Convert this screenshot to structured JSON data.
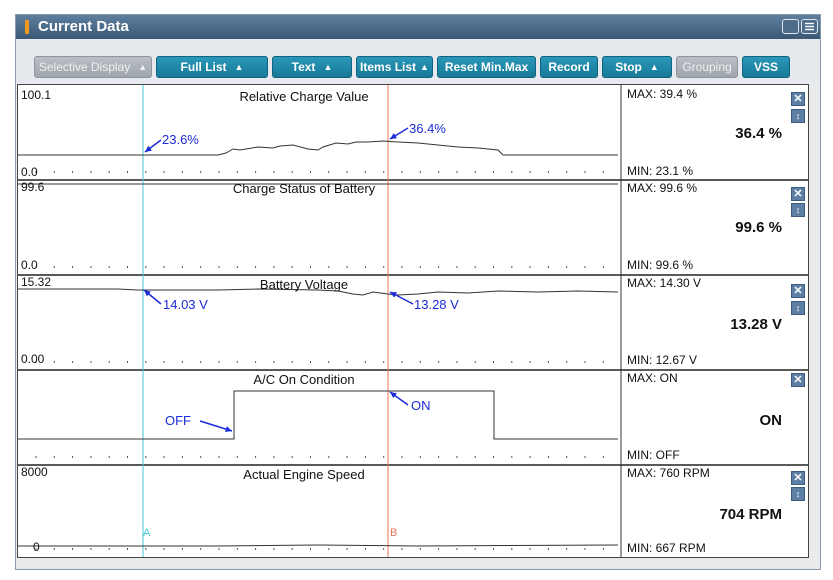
{
  "window": {
    "title": "Current Data"
  },
  "toolbar": {
    "selective_display": "Selective Display",
    "full_list": "Full List",
    "text": "Text",
    "items_list": "Items List",
    "reset_minmax": "Reset Min.Max",
    "record": "Record",
    "stop": "Stop",
    "grouping": "Grouping",
    "vss": "VSS"
  },
  "colors": {
    "accent": "#1e88ab",
    "cursor_a": "#46c6d6",
    "cursor_b": "#e8735a",
    "annotation": "#1b2bd8"
  },
  "cursors": {
    "a_label": "A",
    "b_label": "B"
  },
  "panels": [
    {
      "title": "Relative Charge Value",
      "ymax": "100.1",
      "ymin": "0.0",
      "max": "MAX:  39.4 %",
      "min": "MIN:  23.1 %",
      "current": "36.4 %",
      "annotation_a": "23.6%",
      "annotation_b": "36.4%"
    },
    {
      "title": "Charge Status of Battery",
      "ymax": "99.6",
      "ymin": "0.0",
      "max": "MAX:  99.6 %",
      "min": "MIN:  99.6 %",
      "current": "99.6 %"
    },
    {
      "title": "Battery Voltage",
      "ymax": "15.32",
      "ymin": "0.00",
      "max": "MAX:  14.30 V",
      "min": "MIN:  12.67 V",
      "current": "13.28 V",
      "annotation_a": "14.03 V",
      "annotation_b": "13.28 V"
    },
    {
      "title": "A/C On Condition",
      "max": "MAX:  ON",
      "min": "MIN:  OFF",
      "current": "ON",
      "annotation_a": "OFF",
      "annotation_b": "ON"
    },
    {
      "title": "Actual Engine Speed",
      "ymax": "8000",
      "ymin": "0",
      "max": "MAX:    760 RPM",
      "min": "MIN:    667 RPM",
      "current": "704 RPM"
    }
  ]
}
